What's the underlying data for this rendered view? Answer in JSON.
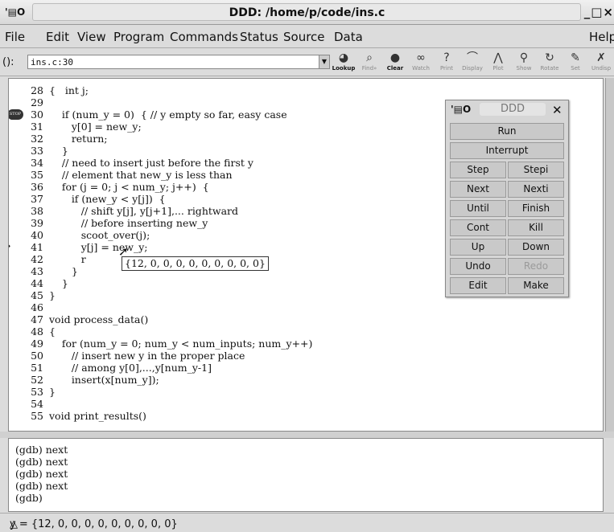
{
  "window": {
    "title": "DDD: /home/p/code/ins.c",
    "controls": "_□×"
  },
  "menubar": [
    "File",
    "Edit",
    "View",
    "Program",
    "Commands",
    "Status",
    "Source",
    "Data"
  ],
  "help": "Help",
  "argbar": {
    "label": "():",
    "value": "ins.c:30"
  },
  "toolbar": [
    {
      "label": "Lookup",
      "icon": "◕",
      "active": true
    },
    {
      "label": "Find»",
      "icon": "⌕",
      "active": false
    },
    {
      "label": "Clear",
      "icon": "●",
      "active": true
    },
    {
      "label": "Watch",
      "icon": "∞",
      "active": false
    },
    {
      "label": "Print",
      "icon": "?",
      "active": false
    },
    {
      "label": "Display",
      "icon": "⌒",
      "active": false
    },
    {
      "label": "Plot",
      "icon": "⋀",
      "active": false
    },
    {
      "label": "Show",
      "icon": "⚲",
      "active": false
    },
    {
      "label": "Rotate",
      "icon": "↻",
      "active": false
    },
    {
      "label": "Set",
      "icon": "✎",
      "active": false
    },
    {
      "label": "Undisp",
      "icon": "✗",
      "active": false
    }
  ],
  "source": [
    {
      "n": "28",
      "code": "{   int j;"
    },
    {
      "n": "29",
      "code": ""
    },
    {
      "n": "30",
      "code": "    if (num_y = 0)  { // y empty so far, easy case",
      "stop": true
    },
    {
      "n": "31",
      "code": "       y[0] = new_y;"
    },
    {
      "n": "32",
      "code": "       return;"
    },
    {
      "n": "33",
      "code": "    }"
    },
    {
      "n": "34",
      "code": "    // need to insert just before the first y"
    },
    {
      "n": "35",
      "code": "    // element that new_y is less than"
    },
    {
      "n": "36",
      "code": "    for (j = 0; j < num_y; j++)  {"
    },
    {
      "n": "37",
      "code": "       if (new_y < y[j])  {"
    },
    {
      "n": "38",
      "code": "          // shift y[j], y[j+1],... rightward"
    },
    {
      "n": "39",
      "code": "          // before inserting new_y"
    },
    {
      "n": "40",
      "code": "          scoot_over(j);"
    },
    {
      "n": "41",
      "code": "          y[j] = new_y;",
      "pc": true
    },
    {
      "n": "42",
      "code": "          r"
    },
    {
      "n": "43",
      "code": "       }"
    },
    {
      "n": "44",
      "code": "    }"
    },
    {
      "n": "45",
      "code": "}"
    },
    {
      "n": "46",
      "code": ""
    },
    {
      "n": "47",
      "code": "void process_data()"
    },
    {
      "n": "48",
      "code": "{"
    },
    {
      "n": "49",
      "code": "    for (num_y = 0; num_y < num_inputs; num_y++)"
    },
    {
      "n": "50",
      "code": "       // insert new y in the proper place"
    },
    {
      "n": "51",
      "code": "       // among y[0],...,y[num_y-1]"
    },
    {
      "n": "52",
      "code": "       insert(x[num_y]);"
    },
    {
      "n": "53",
      "code": "}"
    },
    {
      "n": "54",
      "code": ""
    },
    {
      "n": "55",
      "code": "void print_results()"
    }
  ],
  "value_tip": "{12, 0, 0, 0, 0, 0, 0, 0, 0, 0}",
  "gdb": [
    "(gdb) next",
    "(gdb) next",
    "(gdb) next",
    "(gdb) next",
    "(gdb)"
  ],
  "status": "y = {12, 0, 0, 0, 0, 0, 0, 0, 0, 0}",
  "panel": {
    "title": "DDD",
    "buttons": [
      {
        "label": "Run",
        "wide": true
      },
      {
        "label": "Interrupt",
        "wide": true
      },
      {
        "label": "Step"
      },
      {
        "label": "Stepi"
      },
      {
        "label": "Next"
      },
      {
        "label": "Nexti"
      },
      {
        "label": "Until"
      },
      {
        "label": "Finish"
      },
      {
        "label": "Cont"
      },
      {
        "label": "Kill"
      },
      {
        "label": "Up"
      },
      {
        "label": "Down"
      },
      {
        "label": "Undo"
      },
      {
        "label": "Redo",
        "disabled": true
      },
      {
        "label": "Edit"
      },
      {
        "label": "Make"
      }
    ]
  }
}
